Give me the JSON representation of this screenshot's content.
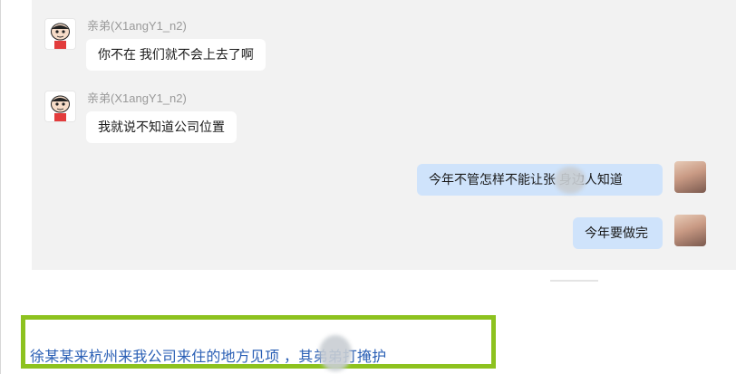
{
  "messages": [
    {
      "sender": "亲弟(X1angY1_n2)",
      "text": "你不在 我们就不会上去了啊",
      "direction": "incoming"
    },
    {
      "sender": "亲弟(X1angY1_n2)",
      "text": "我就说不知道公司位置",
      "direction": "incoming"
    },
    {
      "text": "今年不管怎样不能让张 身边人知道",
      "direction": "outgoing"
    },
    {
      "text": "今年要做完",
      "direction": "outgoing"
    }
  ],
  "caption": "徐某某来杭州来我公司来住的地方见项 ，其弟弟打掩护",
  "colors": {
    "incoming_bubble": "#ffffff",
    "outgoing_bubble": "#cfe3fb",
    "highlight_border": "#8dc21f",
    "caption_text": "#2a5fb5"
  }
}
